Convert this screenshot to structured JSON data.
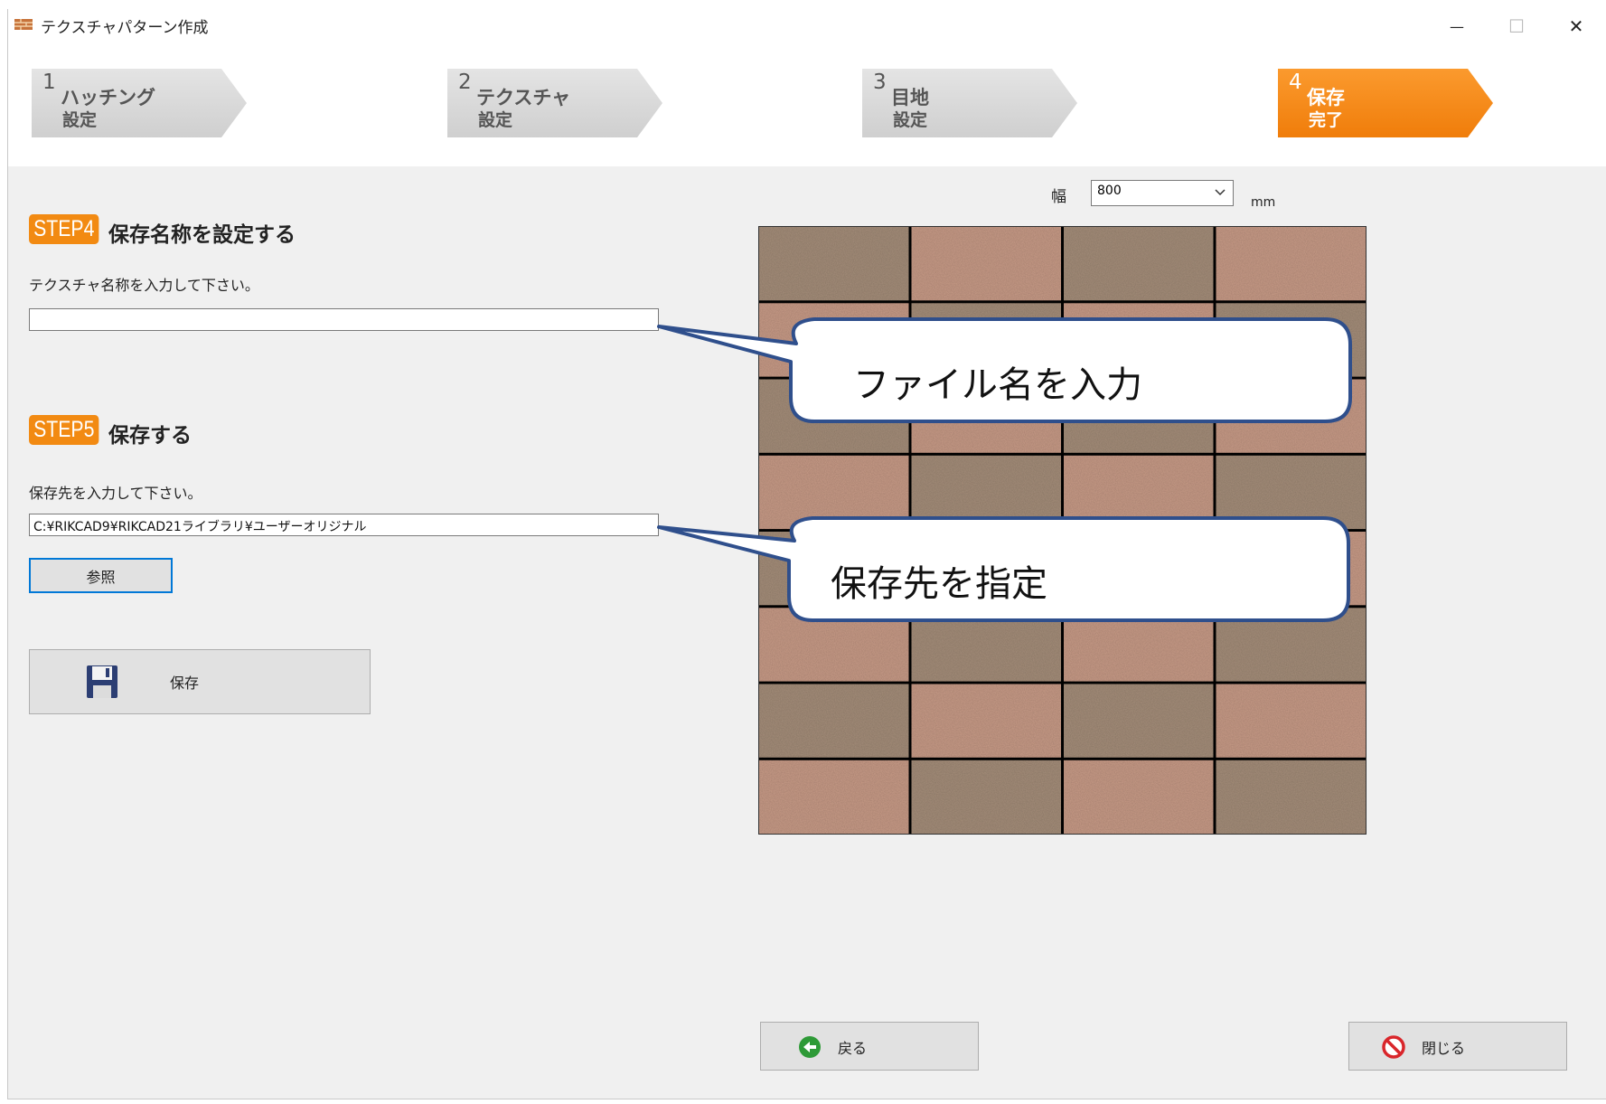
{
  "window": {
    "title": "テクスチャパターン作成",
    "minimize_glyph": "—",
    "maximize_glyph": "☐",
    "close_glyph": "✕"
  },
  "steps": [
    {
      "number": "1",
      "line1": "ハッチング",
      "line2": "設定",
      "active": false
    },
    {
      "number": "2",
      "line1": "テクスチャ",
      "line2": "設定",
      "active": false
    },
    {
      "number": "3",
      "line1": "目地",
      "line2": "設定",
      "active": false
    },
    {
      "number": "4",
      "line1": "保存",
      "line2": "完了",
      "active": true
    }
  ],
  "step4": {
    "badge": "STEP4",
    "title": "保存名称を設定する",
    "instruction": "テクスチャ名称を入力して下さい。",
    "name_value": ""
  },
  "step5": {
    "badge": "STEP5",
    "title": "保存する",
    "instruction": "保存先を入力して下さい。",
    "path_value": "C:¥RIKCAD9¥RIKCAD21ライブラリ¥ユーザーオリジナル",
    "browse_label": "参照",
    "save_label": "保存"
  },
  "preview": {
    "width_label": "幅",
    "width_value": "800",
    "unit": "mm",
    "rows": 8,
    "cols": 4,
    "colors": {
      "light": "#c89b87",
      "dark": "#a58e7a",
      "joint": "#0a0a0a"
    }
  },
  "callouts": {
    "file_name": "ファイル名を入力",
    "destination": "保存先を指定"
  },
  "footer": {
    "back_label": "戻る",
    "close_label": "閉じる"
  },
  "colors": {
    "accent_orange": "#f28a12",
    "callout_border": "#2f4f8c",
    "back_icon_green": "#2e9a37",
    "close_icon_red": "#d9262b"
  },
  "icons": {
    "app": "brick-app-icon",
    "save": "floppy-disk-icon",
    "back": "back-arrow-icon",
    "close": "no-entry-icon",
    "dropdown": "chevron-down-icon"
  }
}
